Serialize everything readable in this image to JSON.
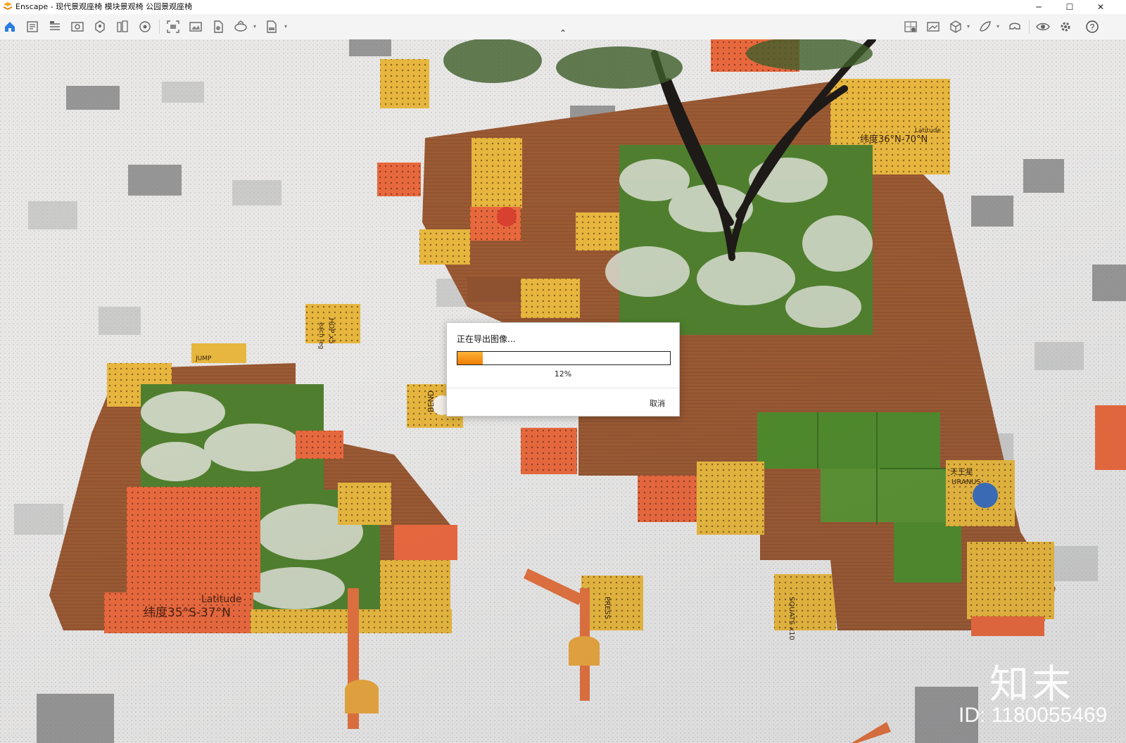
{
  "window": {
    "title": "Enscape - 现代景观座椅 模块景观椅 公园景观座椅",
    "minimize_glyph": "─",
    "maximize_glyph": "☐",
    "close_glyph": "✕"
  },
  "toolbar": {
    "left_icons": [
      "home-icon",
      "project-notes-icon",
      "bim-icon",
      "view-management-icon",
      "asset-library-icon",
      "material-editor-icon",
      "atmosphere-icon",
      "screenshot-icon",
      "batch-render-icon",
      "video-icon",
      "panorama-icon",
      "export-icon"
    ],
    "right_icons": [
      "site-context-icon",
      "image-settings-icon",
      "cube-view-icon",
      "feedback-icon",
      "vr-headset-icon",
      "live-updates-icon",
      "settings-icon",
      "help-icon"
    ],
    "collapse_glyph": "⌃"
  },
  "dialog": {
    "message": "正在导出图像...",
    "progress": 0.12,
    "progress_text": "12%",
    "cancel_label": "取消"
  },
  "scene_labels": {
    "latitude_right": "纬度36°N-70°N",
    "latitude_right_en": "Latitude",
    "latitude_left": "纬度35°S-37°N",
    "latitude_left_en": "Latitude",
    "uranus_cn": "天王星",
    "uranus_en": "URANUS",
    "bend": "BEND",
    "squats": "SQUATS x10",
    "press": "PRESS",
    "jump": "JUMP",
    "hop": "HOP x5",
    "each_leg": "each leg"
  },
  "watermark": {
    "logo": "知末",
    "id_text": "ID: 1180055469"
  },
  "colors": {
    "orange": "#e8683e",
    "yellow": "#e6b63e",
    "wood": "#9a5a34",
    "grass": "#4f7f2e",
    "progress_accent": "#f07d00"
  }
}
